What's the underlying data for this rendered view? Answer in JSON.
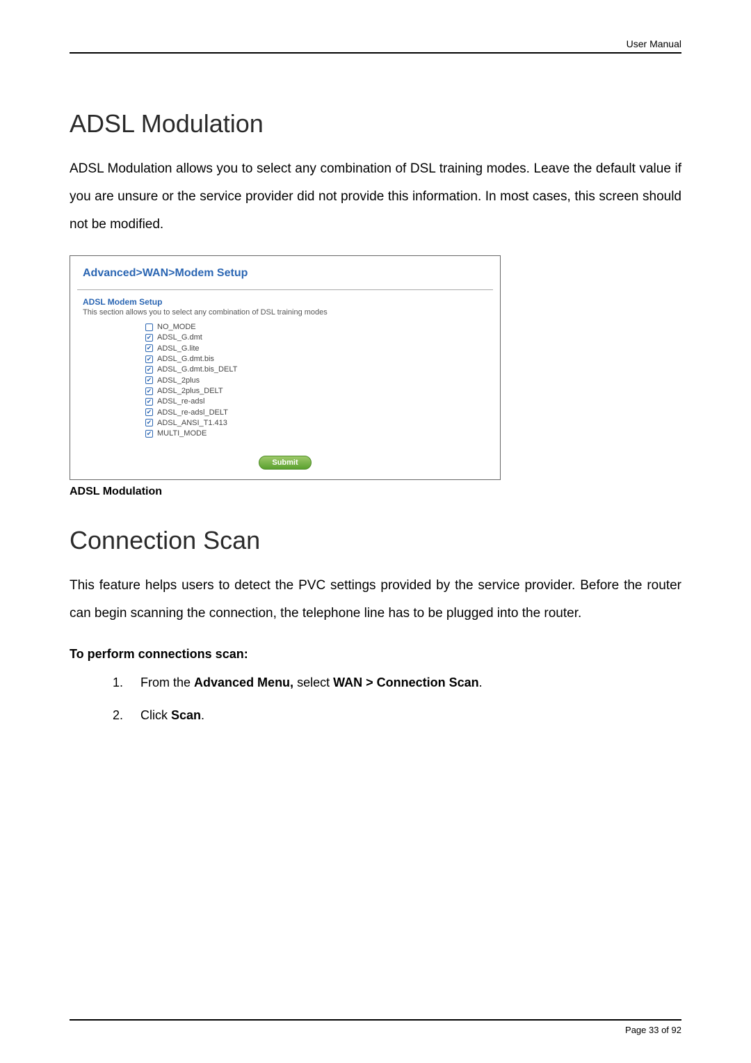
{
  "header": {
    "label": "User Manual"
  },
  "section1": {
    "title": "ADSL Modulation",
    "body": "ADSL Modulation allows you to select any combination of DSL training modes. Leave the default value if you are unsure or the service provider did not provide this information. In most cases, this screen should not be modified."
  },
  "panel": {
    "breadcrumb": "Advanced>WAN>Modem Setup",
    "sub_title": "ADSL Modem Setup",
    "description": "This section allows you to select any combination of DSL training modes",
    "options": [
      {
        "label": "NO_MODE",
        "checked": false
      },
      {
        "label": "ADSL_G.dmt",
        "checked": true
      },
      {
        "label": "ADSL_G.lite",
        "checked": true
      },
      {
        "label": "ADSL_G.dmt.bis",
        "checked": true
      },
      {
        "label": "ADSL_G.dmt.bis_DELT",
        "checked": true
      },
      {
        "label": "ADSL_2plus",
        "checked": true
      },
      {
        "label": "ADSL_2plus_DELT",
        "checked": true
      },
      {
        "label": "ADSL_re-adsl",
        "checked": true
      },
      {
        "label": "ADSL_re-adsl_DELT",
        "checked": true
      },
      {
        "label": "ADSL_ANSI_T1.413",
        "checked": true
      },
      {
        "label": "MULTI_MODE",
        "checked": true
      }
    ],
    "submit": "Submit"
  },
  "caption1": "ADSL Modulation",
  "section2": {
    "title": "Connection Scan",
    "body": "This feature helps users to detect the PVC settings provided by the service provider. Before the router can begin scanning the connection, the telephone line has to be plugged into the router."
  },
  "procedure": {
    "title": "To perform connections scan:",
    "steps": {
      "s1_pre": "From the ",
      "s1_b1": "Advanced Menu,",
      "s1_mid": " select ",
      "s1_b2": "WAN > Connection Scan",
      "s1_post": ".",
      "s2_pre": "Click ",
      "s2_b1": "Scan",
      "s2_post": "."
    }
  },
  "footer": {
    "page": "Page 33 of 92"
  }
}
